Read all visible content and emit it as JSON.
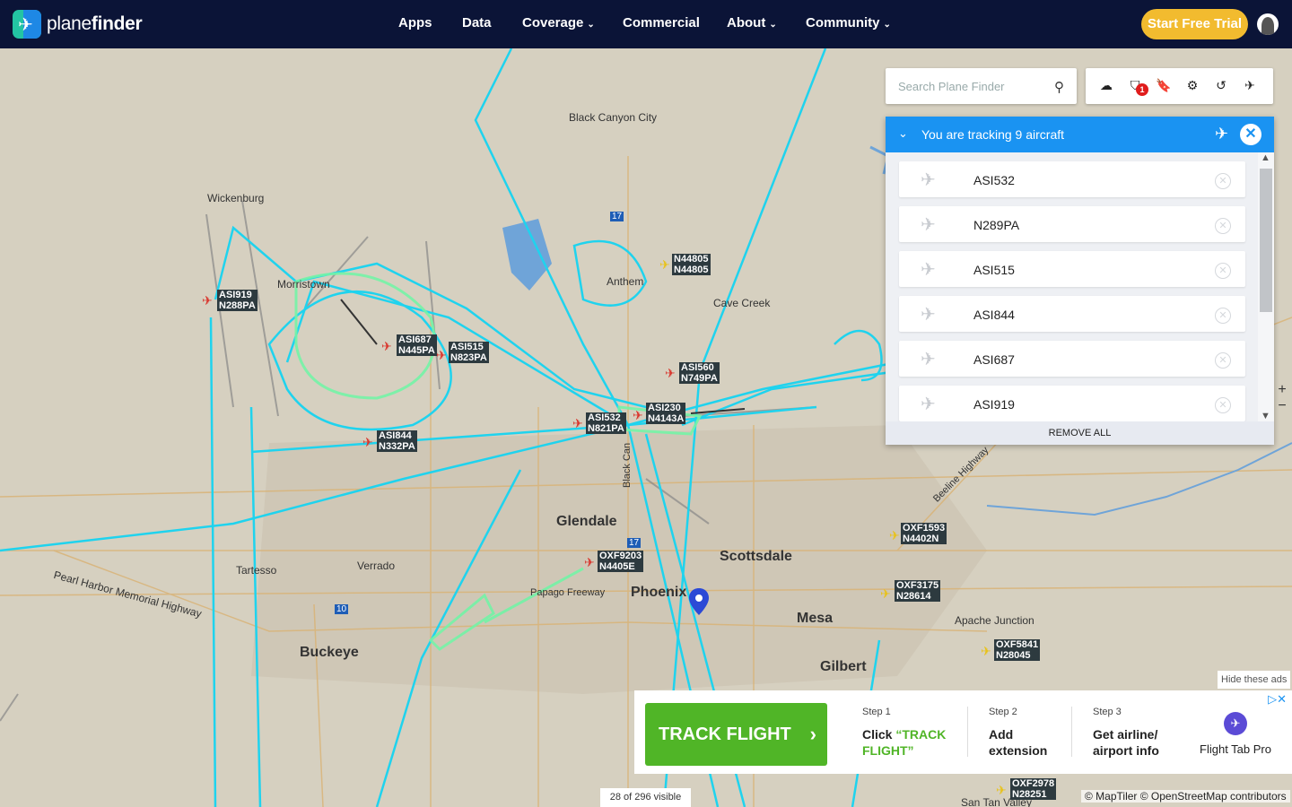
{
  "brand": {
    "name_light": "plane",
    "name_bold": "finder"
  },
  "nav": {
    "apps": "Apps",
    "data": "Data",
    "coverage": "Coverage",
    "commercial": "Commercial",
    "about": "About",
    "community": "Community"
  },
  "cta": {
    "start_trial": "Start Free Trial"
  },
  "search": {
    "placeholder": "Search Plane Finder"
  },
  "toolbar": {
    "filter_badge": "1"
  },
  "tracking": {
    "title": "You are tracking 9 aircraft",
    "items": [
      "ASI532",
      "N289PA",
      "ASI515",
      "ASI844",
      "ASI687",
      "ASI919"
    ],
    "remove_all": "REMOVE ALL"
  },
  "map": {
    "cities": {
      "black_canyon": "Black Canyon City",
      "wickenburg": "Wickenburg",
      "morristown": "Morristown",
      "anthem": "Anthem",
      "cave_creek": "Cave Creek",
      "glendale": "Glendale",
      "phoenix": "Phoenix",
      "scottsdale": "Scottsdale",
      "mesa": "Mesa",
      "gilbert": "Gilbert",
      "buckeye": "Buckeye",
      "verrado": "Verrado",
      "tartesso": "Tartesso",
      "apache_junction": "Apache Junction",
      "san_tan_valley": "San Tan Valley",
      "pearl_harbor_hwy": "Pearl Harbor Memorial Highway",
      "papago": "Papago Freeway",
      "beeline": "Beeline Highway",
      "black_canyon_fwy": "Black Can",
      "i17": "17",
      "i17b": "17",
      "i10": "10"
    },
    "flights": [
      {
        "l1": "ASI919",
        "l2": "N288PA",
        "color": "#d9372e"
      },
      {
        "l1": "ASI687",
        "l2": "N445PA",
        "color": "#d9372e"
      },
      {
        "l1": "ASI515",
        "l2": "N823PA",
        "color": "#d9372e"
      },
      {
        "l1": "ASI844",
        "l2": "N332PA",
        "color": "#d9372e"
      },
      {
        "l1": "ASI532",
        "l2": "N821PA",
        "color": "#d9372e"
      },
      {
        "l1": "ASI230",
        "l2": "N4143A",
        "color": "#d9372e"
      },
      {
        "l1": "ASI560",
        "l2": "N749PA",
        "color": "#d9372e"
      },
      {
        "l1": "N44805",
        "l2": "N44805",
        "color": "#e8c21a"
      },
      {
        "l1": "OXF9203",
        "l2": "N4405E",
        "color": "#d9372e"
      },
      {
        "l1": "OXF1593",
        "l2": "N4402N",
        "color": "#e8c21a"
      },
      {
        "l1": "OXF3175",
        "l2": "N28614",
        "color": "#e8c21a"
      },
      {
        "l1": "OXF5841",
        "l2": "N28045",
        "color": "#e8c21a"
      },
      {
        "l1": "OXF2978",
        "l2": "N28251",
        "color": "#e8c21a"
      }
    ],
    "visible_count": "28 of 296 visible",
    "attribution": "© MapTiler © OpenStreetMap contributors"
  },
  "ad": {
    "hide": "Hide these ads",
    "button": "TRACK FLIGHT",
    "step1_label": "Step 1",
    "step1_a": "Click ",
    "step1_em": "“TRACK FLIGHT”",
    "step2_label": "Step 2",
    "step2": "Add extension",
    "step3_label": "Step 3",
    "step3": "Get airline/ airport info",
    "product": "Flight Tab Pro"
  }
}
